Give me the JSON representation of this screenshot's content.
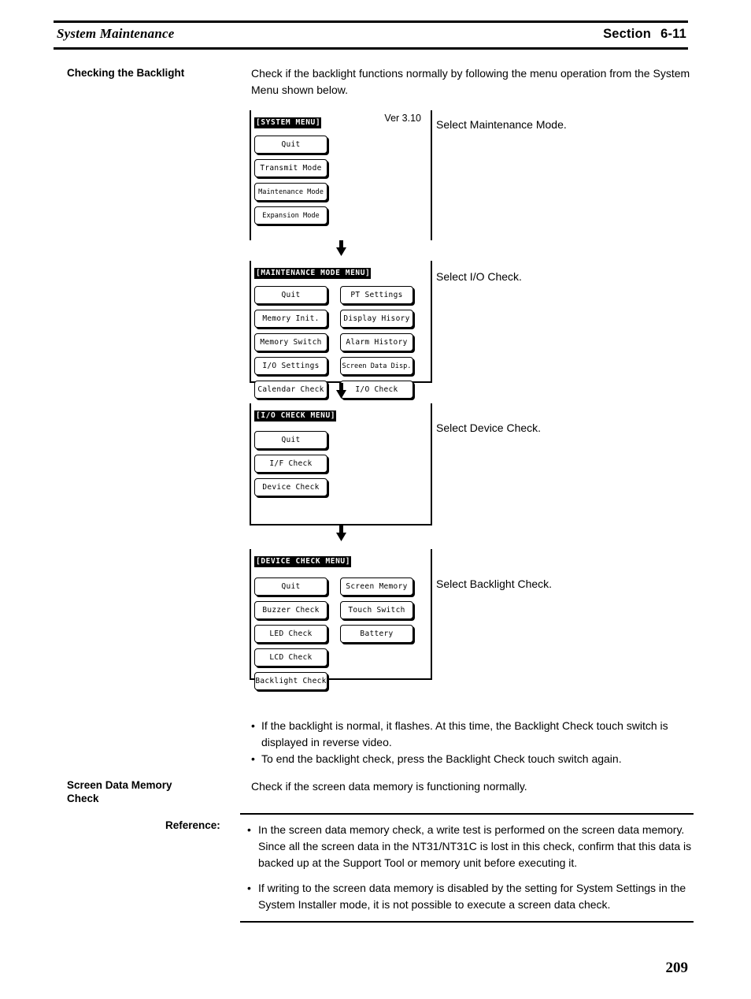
{
  "header": {
    "doc_title": "System Maintenance",
    "section_word": "Section",
    "section_number": "6-11"
  },
  "backlight_section": {
    "label": "Checking the Backlight",
    "body": "Check if the backlight functions normally by following the menu operation from the System Menu shown below."
  },
  "flow": {
    "screens": [
      {
        "title": "[SYSTEM MENU]",
        "version": "Ver 3.10",
        "step_note": "Select Maintenance Mode.",
        "columns": [
          [
            "Quit",
            "Transmit Mode",
            "Maintenance Mode",
            "Expansion Mode"
          ]
        ]
      },
      {
        "title": "[MAINTENANCE MODE MENU]",
        "version": "",
        "step_note": "Select I/O Check.",
        "columns": [
          [
            "Quit",
            "Memory Init.",
            "Memory Switch",
            "I/O Settings",
            "Calendar Check"
          ],
          [
            "PT Settings",
            "Display Hisory",
            "Alarm History",
            "Screen Data Disp.",
            "I/O Check"
          ]
        ]
      },
      {
        "title": "[I/O CHECK MENU]",
        "version": "",
        "step_note": "Select Device Check.",
        "columns": [
          [
            "Quit",
            "I/F Check",
            "Device Check"
          ]
        ]
      },
      {
        "title": "[DEVICE CHECK MENU]",
        "version": "",
        "step_note": "Select Backlight Check.",
        "columns": [
          [
            "Quit",
            "Buzzer Check",
            "LED Check",
            "LCD Check",
            "Backlight Check"
          ],
          [
            "Screen Memory",
            "Touch Switch",
            "Battery"
          ]
        ]
      }
    ],
    "arrow_icon": "down-arrow-icon"
  },
  "backlight_notes": {
    "bullet_char": "•",
    "items": [
      "If the backlight is normal, it flashes. At this time, the Backlight Check touch switch is displayed in reverse video.",
      "To end the backlight check, press the Backlight Check touch switch again."
    ]
  },
  "memory_section": {
    "label_line1": "Screen Data Memory",
    "label_line2": "Check",
    "body": "Check if the screen data memory is functioning normally."
  },
  "reference": {
    "label": "Reference:",
    "bullet_char": "•",
    "items": [
      "In the screen data memory check, a write test is performed on the screen data memory. Since all the screen data in the NT31/NT31C is lost in this check, confirm that this data is backed up at the Support Tool or memory unit before executing it.",
      "If writing to the screen data memory is disabled by the setting for System Settings in the System Installer mode, it is not possible to execute a screen data check."
    ]
  },
  "footer": {
    "page_number": "209"
  }
}
